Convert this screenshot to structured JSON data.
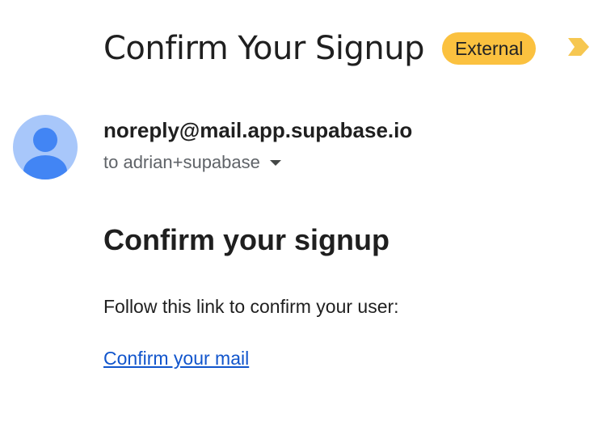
{
  "email": {
    "subject": "Confirm Your Signup",
    "label_badge": "External",
    "importance_icon": "importance-marker-icon",
    "importance_color": "#f6c751",
    "sender": {
      "address": "noreply@mail.app.supabase.io",
      "avatar_icon": "person-avatar-icon",
      "avatar_bg": "#a8c7fa",
      "avatar_fg": "#4285f4"
    },
    "recipient_line": "to adrian+supabase",
    "recipient_toggle_icon": "caret-down-icon",
    "body": {
      "heading": "Confirm your signup",
      "text": "Follow this link to confirm your user:",
      "link_text": "Confirm your mail"
    }
  },
  "colors": {
    "badge_bg": "#fbc13f",
    "link": "#1155cc",
    "text": "#1f1f1f",
    "muted": "#5f6368"
  }
}
